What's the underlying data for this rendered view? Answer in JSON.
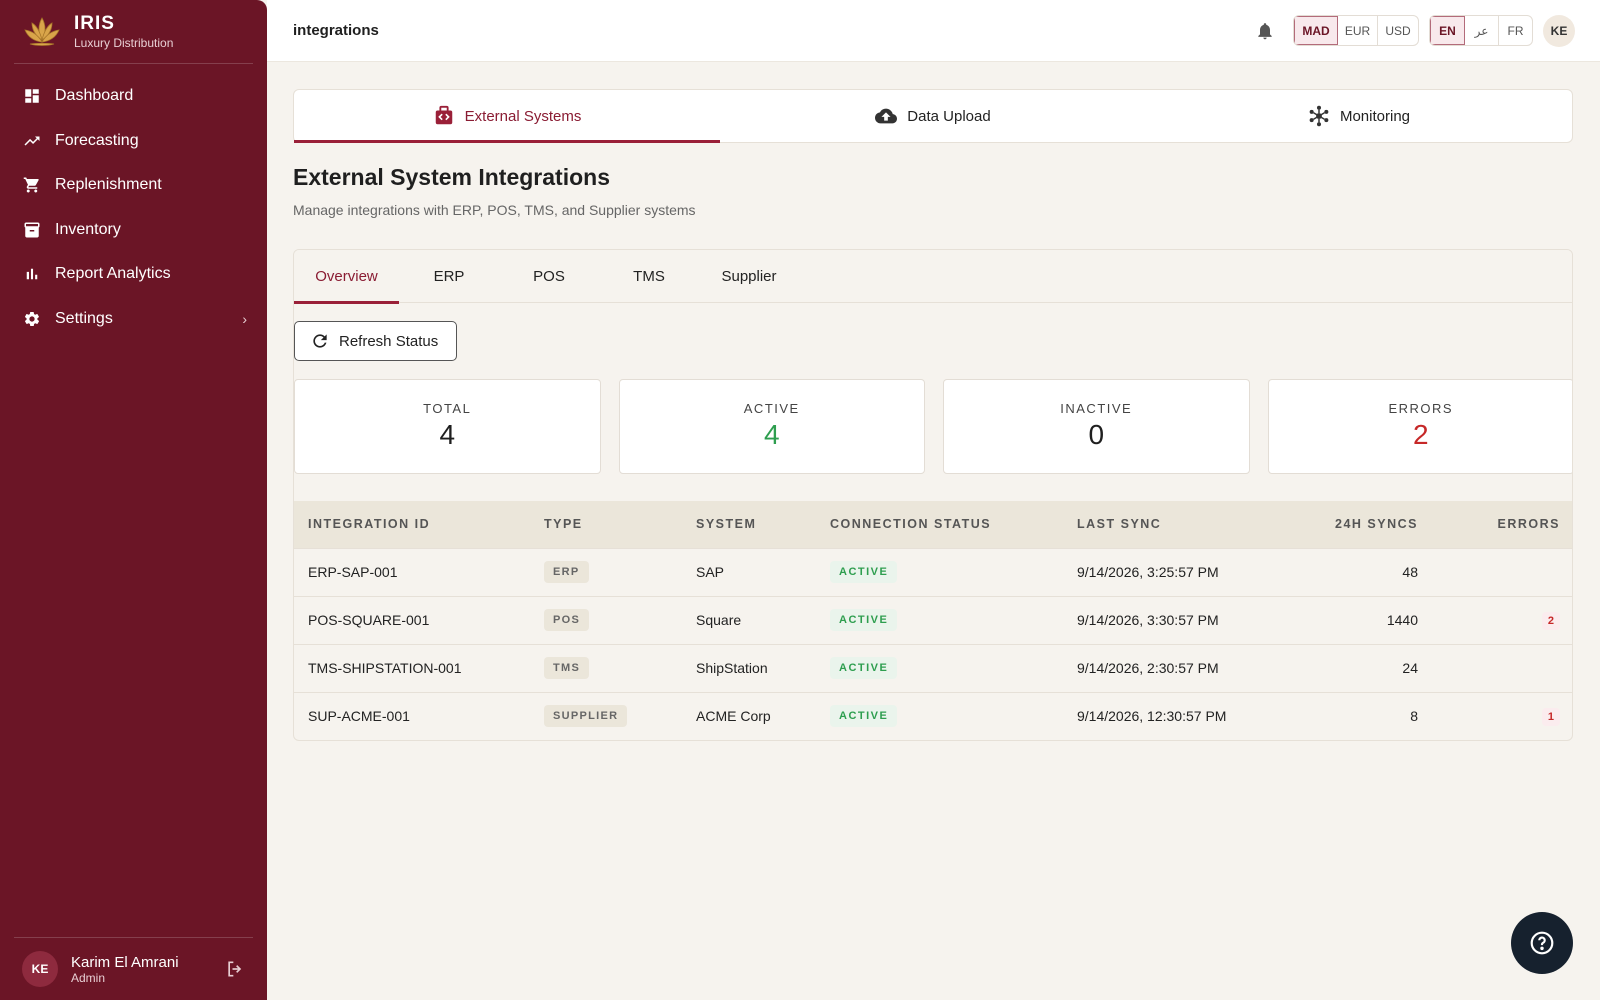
{
  "brand": {
    "title": "IRIS",
    "subtitle": "Luxury Distribution"
  },
  "sidebar": {
    "items": [
      {
        "label": "Dashboard",
        "icon": "dashboard-icon"
      },
      {
        "label": "Forecasting",
        "icon": "trend-icon"
      },
      {
        "label": "Replenishment",
        "icon": "cart-icon"
      },
      {
        "label": "Inventory",
        "icon": "archive-icon"
      },
      {
        "label": "Report Analytics",
        "icon": "bar-chart-icon"
      },
      {
        "label": "Settings",
        "icon": "gear-icon"
      }
    ],
    "settings_chevron": "›"
  },
  "user": {
    "initials": "KE",
    "name": "Karim El Amrani",
    "role": "Admin"
  },
  "topbar": {
    "page_name": "integrations",
    "currencies": [
      "MAD",
      "EUR",
      "USD"
    ],
    "selected_currency": "MAD",
    "languages": [
      "EN",
      "عر",
      "FR"
    ],
    "selected_language": "EN",
    "avatar_initials": "KE"
  },
  "main_tabs": [
    {
      "label": "External Systems",
      "icon": "plug-icon",
      "active": true
    },
    {
      "label": "Data Upload",
      "icon": "cloud-upload-icon",
      "active": false
    },
    {
      "label": "Monitoring",
      "icon": "network-icon",
      "active": false
    }
  ],
  "page": {
    "title": "External System Integrations",
    "description": "Manage integrations with ERP, POS, TMS, and Supplier systems"
  },
  "sub_tabs": [
    "Overview",
    "ERP",
    "POS",
    "TMS",
    "Supplier"
  ],
  "refresh_label": "Refresh Status",
  "stats": [
    {
      "label": "TOTAL",
      "value": "4"
    },
    {
      "label": "ACTIVE",
      "value": "4"
    },
    {
      "label": "INACTIVE",
      "value": "0"
    },
    {
      "label": "ERRORS",
      "value": "2"
    }
  ],
  "table": {
    "headers": [
      "INTEGRATION ID",
      "TYPE",
      "SYSTEM",
      "CONNECTION STATUS",
      "LAST SYNC",
      "24H SYNCS",
      "ERRORS"
    ],
    "rows": [
      {
        "id": "ERP-SAP-001",
        "type": "ERP",
        "system": "SAP",
        "status": "ACTIVE",
        "last_sync": "9/14/2026, 3:25:57 PM",
        "syncs": "48",
        "errors": ""
      },
      {
        "id": "POS-SQUARE-001",
        "type": "POS",
        "system": "Square",
        "status": "ACTIVE",
        "last_sync": "9/14/2026, 3:30:57 PM",
        "syncs": "1440",
        "errors": "2"
      },
      {
        "id": "TMS-SHIPSTATION-001",
        "type": "TMS",
        "system": "ShipStation",
        "status": "ACTIVE",
        "last_sync": "9/14/2026, 2:30:57 PM",
        "syncs": "24",
        "errors": ""
      },
      {
        "id": "SUP-ACME-001",
        "type": "SUPPLIER",
        "system": "ACME Corp",
        "status": "ACTIVE",
        "last_sync": "9/14/2026, 12:30:57 PM",
        "syncs": "8",
        "errors": "1"
      }
    ]
  },
  "colors": {
    "sidebar": "#6b1526",
    "accent": "#9a2038",
    "active_green": "#2e9e4f",
    "error_red": "#c62828"
  }
}
